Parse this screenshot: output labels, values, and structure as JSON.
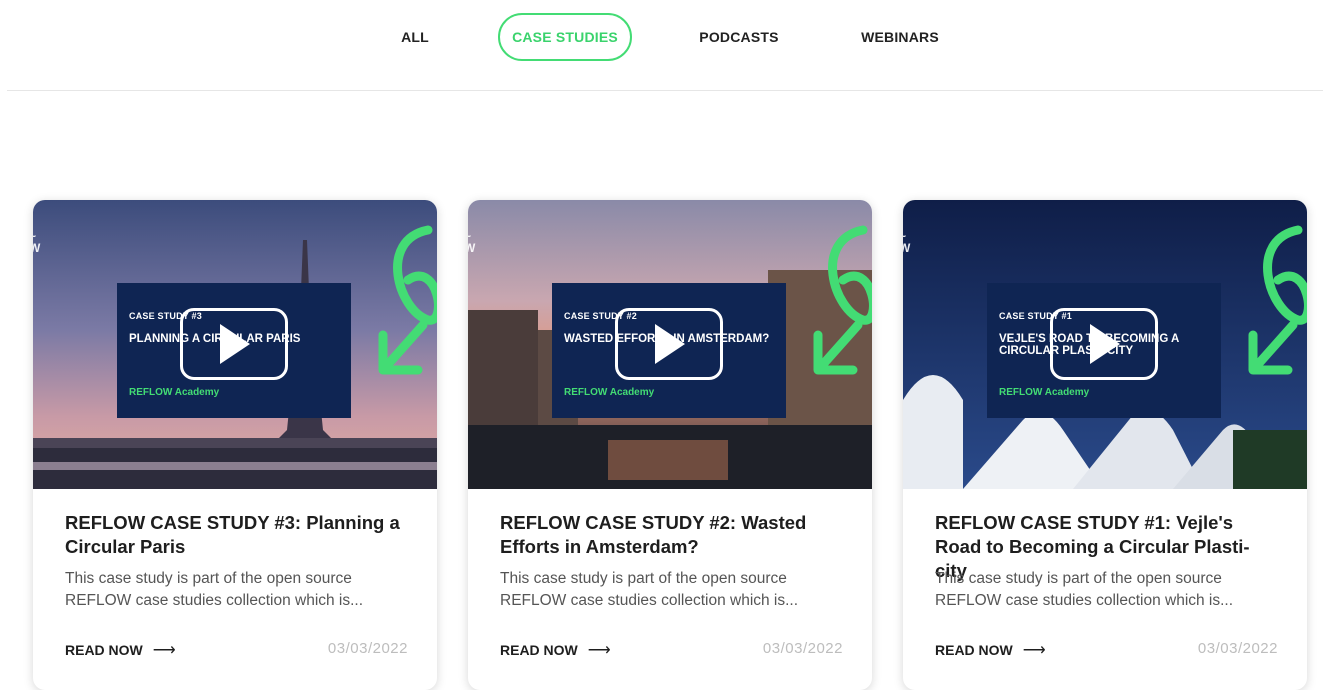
{
  "tabs": [
    {
      "label": "ALL",
      "active": false
    },
    {
      "label": "CASE STUDIES",
      "active": true
    },
    {
      "label": "PODCASTS",
      "active": false
    },
    {
      "label": "WEBINARS",
      "active": false
    }
  ],
  "colors": {
    "accent": "#43dc74",
    "overlay": "#0f2553",
    "date": "#bdbdbd"
  },
  "cards": [
    {
      "overlay_eyebrow": "CASE STUDY #3",
      "overlay_title": "PLANNING A CIRCULAR PARIS",
      "overlay_brand": "REFLOW Academy",
      "title": "REFLOW CASE STUDY #3: Planning a Circular Paris",
      "description": "This case study is part of the open source REFLOW case studies collection which is...",
      "read_label": "READ NOW",
      "date": "03/03/2022"
    },
    {
      "overlay_eyebrow": "CASE STUDY #2",
      "overlay_title": "WASTED EFFORTS IN AMSTERDAM?",
      "overlay_brand": "REFLOW Academy",
      "title": "REFLOW CASE STUDY #2: Wasted Efforts in Amsterdam?",
      "description": "This case study is part of the open source REFLOW case studies collection which is...",
      "read_label": "READ NOW",
      "date": "03/03/2022"
    },
    {
      "overlay_eyebrow": "CASE STUDY #1",
      "overlay_title": "VEJLE'S ROAD TO BECOMING A CIRCULAR PLASTI-CITY",
      "overlay_brand": "REFLOW Academy",
      "title": "REFLOW CASE STUDY #1: Vejle's Road to Becoming a Circular Plasti-city",
      "description": "This case study is part of the open source REFLOW case studies collection which is...",
      "read_label": "READ NOW",
      "date": "03/03/2022"
    }
  ]
}
